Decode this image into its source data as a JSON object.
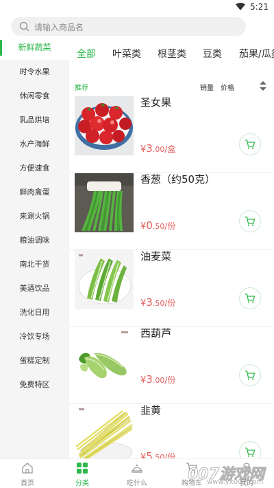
{
  "status": {
    "time": "5:21"
  },
  "search": {
    "placeholder": "请输入商品名"
  },
  "sidebar": {
    "items": [
      {
        "label": "新鲜蔬菜",
        "active": true
      },
      {
        "label": "时令水果"
      },
      {
        "label": "休闲零食"
      },
      {
        "label": "乳品烘培"
      },
      {
        "label": "水产海鲜"
      },
      {
        "label": "方便速食"
      },
      {
        "label": "鲜肉禽蛋"
      },
      {
        "label": "来涮火锅"
      },
      {
        "label": "粮油调味"
      },
      {
        "label": "南北干货"
      },
      {
        "label": "美酒饮品"
      },
      {
        "label": "洗化日用"
      },
      {
        "label": "冷饮专场"
      },
      {
        "label": "蛋糕定制"
      },
      {
        "label": "免费特区"
      }
    ]
  },
  "tabs": [
    {
      "label": "全部",
      "active": true
    },
    {
      "label": "叶菜类"
    },
    {
      "label": "根茎类"
    },
    {
      "label": "豆类"
    },
    {
      "label": "茄果/瓜类"
    }
  ],
  "sort": {
    "recommend": "推荐",
    "sales": "销量",
    "price": "价格"
  },
  "products": [
    {
      "name": "圣女果",
      "currency": "¥",
      "price_int": "3",
      "price_dec": ".00",
      "unit": "/盒"
    },
    {
      "name": "香葱（约50克）",
      "currency": "¥",
      "price_int": "0",
      "price_dec": ".50",
      "unit": "/份"
    },
    {
      "name": "油麦菜",
      "currency": "¥",
      "price_int": "3",
      "price_dec": ".50",
      "unit": "/份"
    },
    {
      "name": "西葫芦",
      "currency": "¥",
      "price_int": "3",
      "price_dec": ".00",
      "unit": "/份"
    },
    {
      "name": "韭黄",
      "currency": "¥",
      "price_int": "5",
      "price_dec": ".50",
      "unit": "/份"
    }
  ],
  "bottom_nav": [
    {
      "label": "首页",
      "icon": "home-icon"
    },
    {
      "label": "分类",
      "icon": "category-icon",
      "active": true
    },
    {
      "label": "吃什么",
      "icon": "dish-icon"
    },
    {
      "label": "购物车",
      "icon": "cart-icon"
    },
    {
      "label": "我的",
      "icon": "user-icon"
    }
  ],
  "watermark": {
    "big": "007游戏网",
    "small": "www.yx007.com"
  },
  "colors": {
    "accent": "#2db84c",
    "price": "#e25c5c",
    "sidebar_bg": "#f5f5f5"
  }
}
